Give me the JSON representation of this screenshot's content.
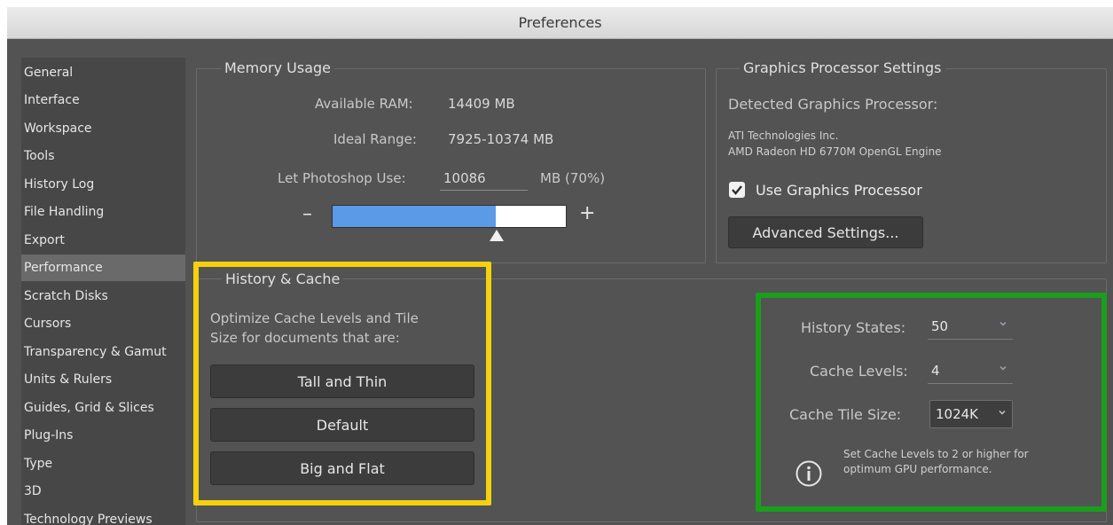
{
  "window": {
    "title": "Preferences"
  },
  "sidebar": {
    "items": [
      {
        "label": "General"
      },
      {
        "label": "Interface"
      },
      {
        "label": "Workspace"
      },
      {
        "label": "Tools"
      },
      {
        "label": "History Log"
      },
      {
        "label": "File Handling"
      },
      {
        "label": "Export"
      },
      {
        "label": "Performance",
        "selected": true
      },
      {
        "label": "Scratch Disks"
      },
      {
        "label": "Cursors"
      },
      {
        "label": "Transparency & Gamut"
      },
      {
        "label": "Units & Rulers"
      },
      {
        "label": "Guides, Grid & Slices"
      },
      {
        "label": "Plug-Ins"
      },
      {
        "label": "Type"
      },
      {
        "label": "3D"
      },
      {
        "label": "Technology Previews"
      }
    ]
  },
  "memory_usage": {
    "title": "Memory Usage",
    "available_ram_label": "Available RAM:",
    "available_ram_value": "14409 MB",
    "ideal_range_label": "Ideal Range:",
    "ideal_range_value": "7925-10374 MB",
    "let_use_label": "Let Photoshop Use:",
    "let_use_value": "10086",
    "let_use_unit": "MB (70%)",
    "slider_fraction": 0.7,
    "minus": "–",
    "plus": "+"
  },
  "graphics": {
    "title": "Graphics Processor Settings",
    "detected_label": "Detected Graphics Processor:",
    "vendor": "ATI Technologies Inc.",
    "model": "AMD Radeon HD 6770M OpenGL Engine",
    "use_gpu_label": "Use Graphics Processor",
    "use_gpu_checked": true,
    "advanced_button": "Advanced Settings..."
  },
  "history_cache": {
    "title": "History & Cache",
    "description_line1": "Optimize Cache Levels and Tile",
    "description_line2": "Size for documents that are:",
    "buttons": [
      "Tall and Thin",
      "Default",
      "Big and Flat"
    ]
  },
  "cache_settings": {
    "history_states_label": "History States:",
    "history_states_value": "50",
    "cache_levels_label": "Cache Levels:",
    "cache_levels_value": "4",
    "cache_tile_label": "Cache Tile Size:",
    "cache_tile_value": "1024K",
    "info_line1": "Set Cache Levels to 2 or higher for",
    "info_line2": "optimum GPU performance."
  },
  "colors": {
    "highlight_yellow": "#f5d10d",
    "highlight_green": "#1b9e1b",
    "slider_fill": "#5b9ae6",
    "panel_bg": "#535353"
  },
  "icons": {
    "info": "info-circle-icon",
    "checkbox": "checkbox-checked-icon",
    "dropdown": "chevron-down-icon"
  }
}
